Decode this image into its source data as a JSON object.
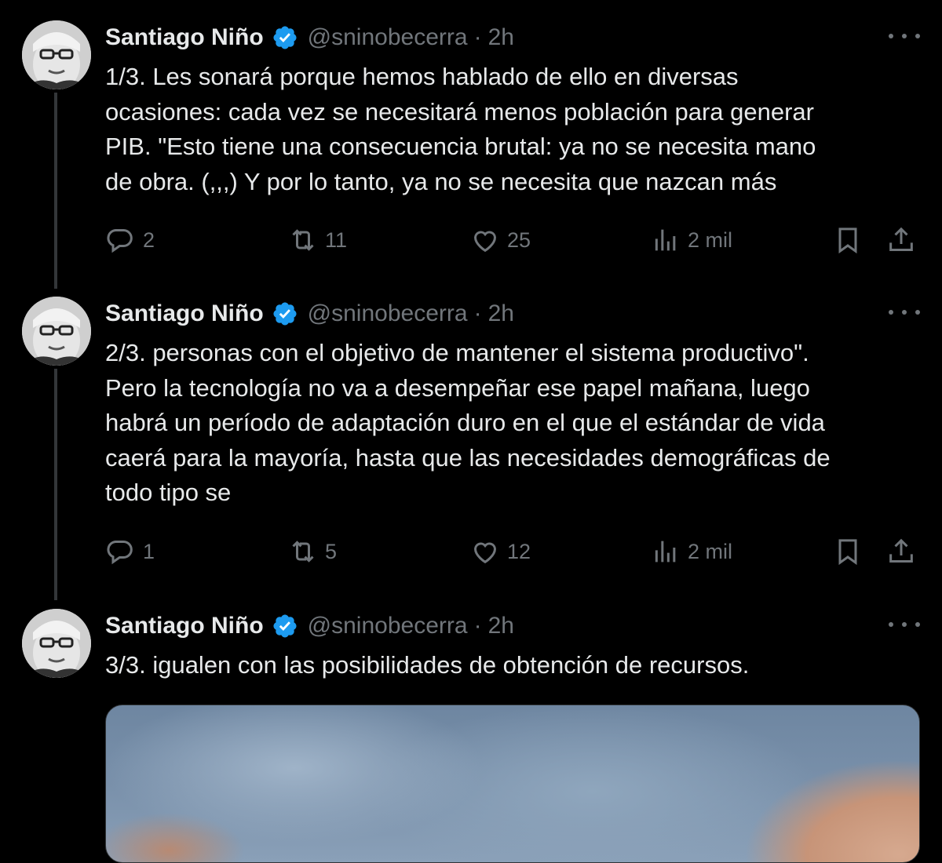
{
  "tweets": [
    {
      "author": "Santiago Niño",
      "handle": "@sninobecerra",
      "separator": "·",
      "time": "2h",
      "text": "1/3. Les sonará porque hemos hablado de ello en diversas\nocasiones: cada vez se necesitará menos población para generar\nPIB. \"Esto tiene una consecuencia brutal: ya no se necesita mano\nde obra. (,,,) Y por lo tanto, ya no se necesita que nazcan más",
      "replies": "2",
      "retweets": "11",
      "likes": "25",
      "views": "2 mil"
    },
    {
      "author": "Santiago Niño",
      "handle": "@sninobecerra",
      "separator": "·",
      "time": "2h",
      "text": "2/3. personas con el objetivo de mantener el sistema productivo\".\nPero la tecnología no va a desempeñar ese papel mañana, luego\nhabrá un período de adaptación duro en el que el estándar de vida\ncaerá para la mayoría,  hasta que las necesidades demográficas de\ntodo tipo se",
      "replies": "1",
      "retweets": "5",
      "likes": "12",
      "views": "2 mil"
    },
    {
      "author": "Santiago Niño",
      "handle": "@sninobecerra",
      "separator": "·",
      "time": "2h",
      "text": "3/3. igualen con las posibilidades de obtención de recursos."
    }
  ],
  "icons": {
    "reply": "reply-icon",
    "retweet": "retweet-icon",
    "like": "heart-icon",
    "views": "views-icon",
    "bookmark": "bookmark-icon",
    "share": "share-icon",
    "more": "more-icon",
    "verified": "verified-badge-icon"
  },
  "colors": {
    "background": "#000000",
    "text": "#e7e9ea",
    "muted": "#71767b",
    "verified": "#1d9bf0",
    "thread_line": "#333639"
  }
}
